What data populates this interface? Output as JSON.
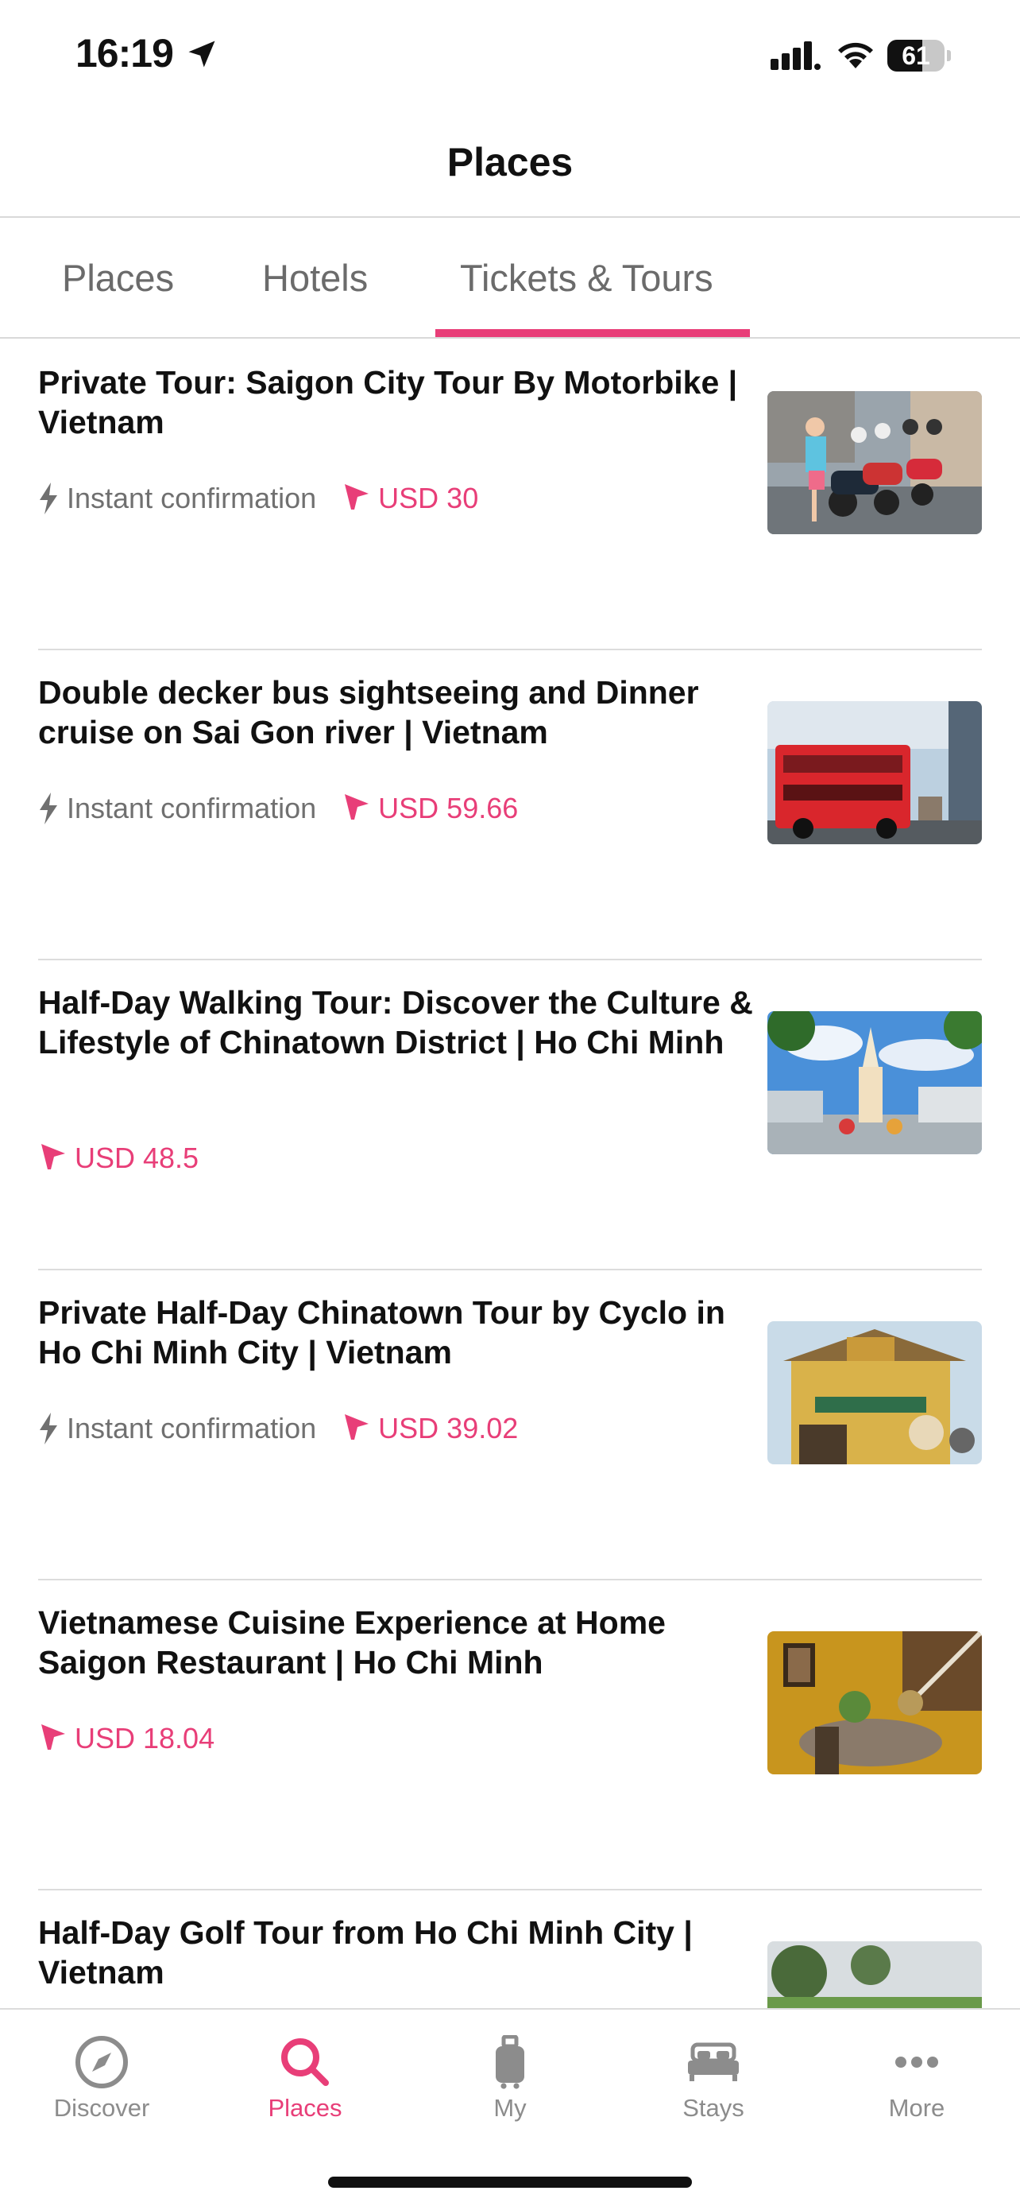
{
  "status_bar": {
    "time": "16:19",
    "battery": "61",
    "battery_level": 0.61
  },
  "header": {
    "title": "Places"
  },
  "tabs": [
    {
      "label": "Places",
      "active": false
    },
    {
      "label": "Hotels",
      "active": false
    },
    {
      "label": "Tickets & Tours",
      "active": true
    }
  ],
  "items": [
    {
      "title": "Private Tour: Saigon City Tour By Motorbike | Vietnam",
      "confirmation": "Instant confirmation",
      "price": "USD 30",
      "image": "motorbike-tour"
    },
    {
      "title": "Double decker bus sightseeing and Dinner cruise on Sai Gon river | Vietnam",
      "confirmation": "Instant confirmation",
      "price": "USD 59.66",
      "image": "double-decker-bus"
    },
    {
      "title": "Half-Day Walking Tour: Discover the Culture & Lifestyle of Chinatown District | Ho Chi Minh",
      "confirmation": "",
      "price": "USD 48.5",
      "image": "chinatown-church"
    },
    {
      "title": "Private Half-Day Chinatown Tour by Cyclo in Ho Chi Minh City | Vietnam",
      "confirmation": "Instant confirmation",
      "price": "USD 39.02",
      "image": "binh-tay-market"
    },
    {
      "title": "Vietnamese Cuisine Experience at Home Saigon Restaurant | Ho Chi Minh",
      "confirmation": "",
      "price": "USD 18.04",
      "image": "restaurant-interior"
    },
    {
      "title": "Half-Day Golf Tour from Ho Chi Minh City | Vietnam",
      "confirmation": "",
      "price": "",
      "image": "golf-course"
    }
  ],
  "tabbar": [
    {
      "label": "Discover",
      "icon": "compass-icon",
      "active": false
    },
    {
      "label": "Places",
      "icon": "search-icon",
      "active": true
    },
    {
      "label": "My",
      "icon": "luggage-icon",
      "active": false
    },
    {
      "label": "Stays",
      "icon": "bed-icon",
      "active": false
    },
    {
      "label": "More",
      "icon": "more-icon",
      "active": false
    }
  ],
  "colors": {
    "accent": "#e83e78",
    "text": "#111111",
    "muted": "#707070",
    "divider": "#dcdcdc"
  }
}
